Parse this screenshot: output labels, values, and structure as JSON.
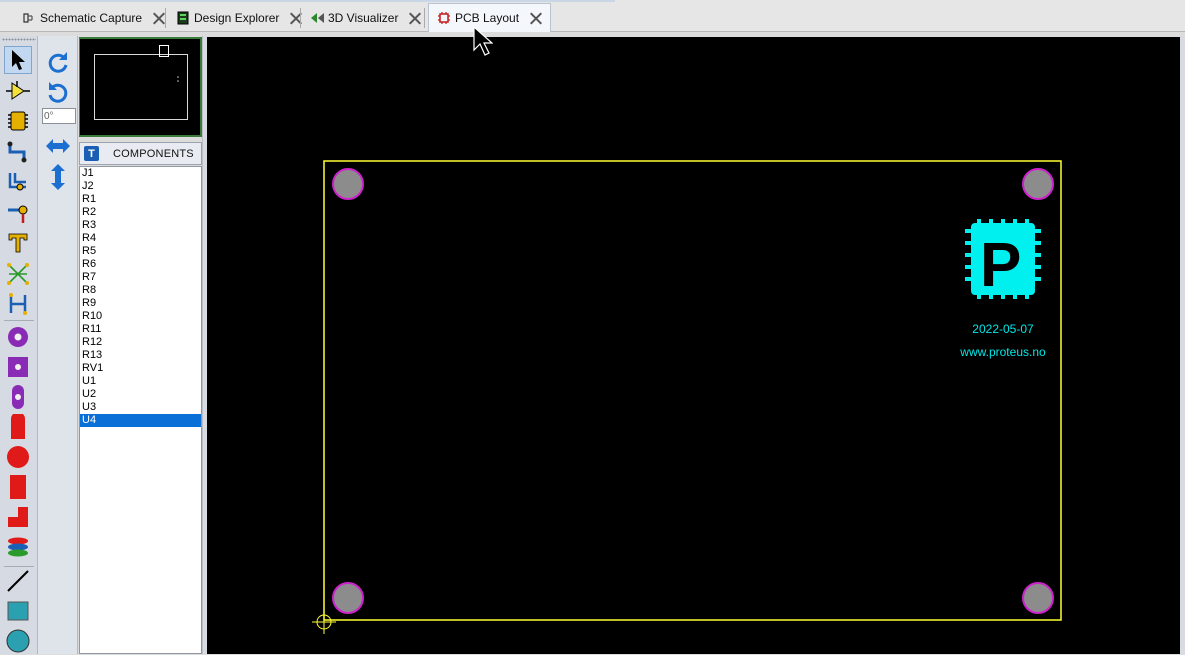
{
  "tabs": [
    {
      "label": "Schematic Capture",
      "icon": "schematic-icon",
      "active": false
    },
    {
      "label": "Design Explorer",
      "icon": "design-explorer-icon",
      "active": false
    },
    {
      "label": "3D Visualizer",
      "icon": "3d-visualizer-icon",
      "active": false
    },
    {
      "label": "PCB Layout",
      "icon": "pcb-layout-icon",
      "active": true
    }
  ],
  "rotation_field": {
    "value": "0°"
  },
  "components_panel": {
    "badge": "T",
    "title": "COMPONENTS",
    "items": [
      "J1",
      "J2",
      "R1",
      "R2",
      "R3",
      "R4",
      "R5",
      "R6",
      "R7",
      "R8",
      "R9",
      "R10",
      "R11",
      "R12",
      "R13",
      "RV1",
      "U1",
      "U2",
      "U3",
      "U4"
    ],
    "selected": "U4"
  },
  "board": {
    "date": "2022-05-07",
    "website": "www.proteus.no",
    "logo_letter": "P"
  },
  "colors": {
    "board_outline": "#ffff33",
    "mount_hole_fill": "#8c8c8c",
    "mount_hole_ring": "#cc22cc",
    "logo": "#00f0f0",
    "text": "#00e8e8",
    "selection": "#0a6fd6"
  }
}
